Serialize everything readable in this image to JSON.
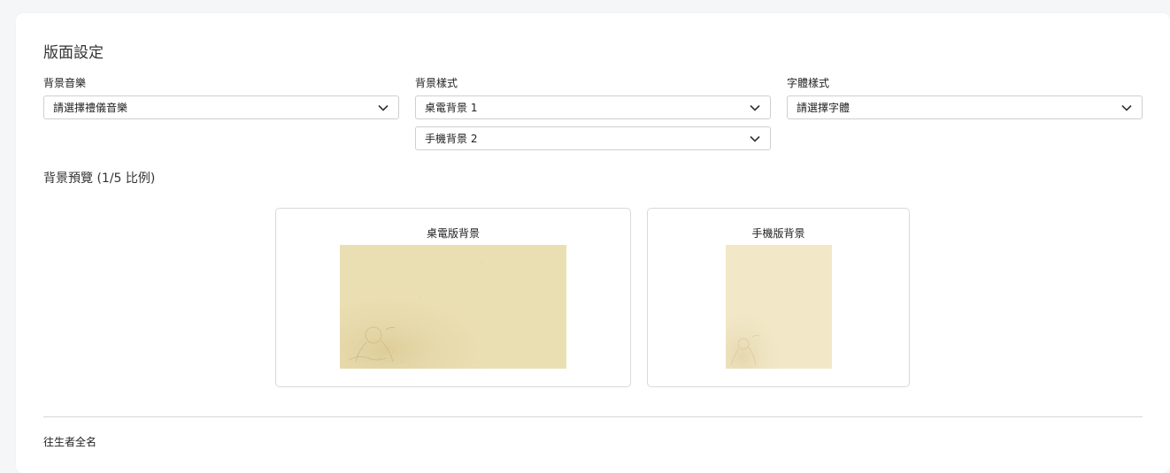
{
  "layout_section": {
    "title": "版面設定",
    "music": {
      "label": "背景音樂",
      "value": "請選擇禮儀音樂"
    },
    "background_style": {
      "label": "背景樣式",
      "desktop_value": "桌電背景 1",
      "mobile_value": "手機背景 2"
    },
    "font_style": {
      "label": "字體樣式",
      "value": "請選擇字體"
    }
  },
  "preview": {
    "title": "背景預覽 (1/5 比例)",
    "desktop_label": "桌電版背景",
    "mobile_label": "手機版背景"
  },
  "next_field": {
    "label": "往生者全名"
  },
  "icons": {
    "dropdown": "chevron-down-icon"
  },
  "colors": {
    "desktop_bg": "#e9dcae",
    "mobile_bg": "#f2e7c6",
    "border": "#cfcfcf"
  }
}
